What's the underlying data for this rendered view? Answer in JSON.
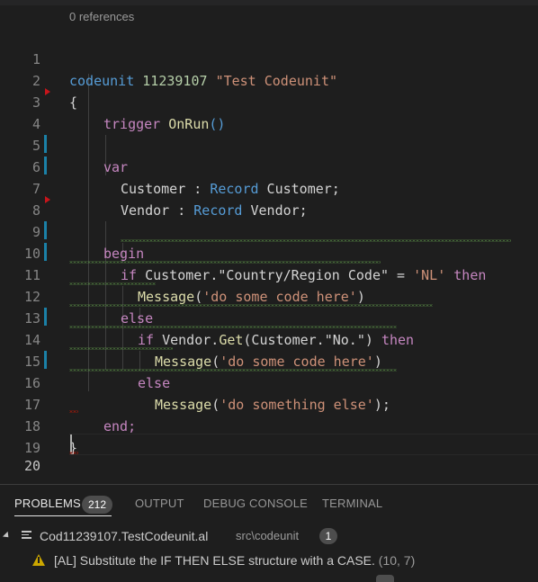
{
  "editor": {
    "codelens": "0 references",
    "lines": [
      {
        "n": "1",
        "text": "codeunit 11239107 \"Test Codeunit\""
      },
      {
        "n": "2",
        "text": "{"
      },
      {
        "n": "3",
        "text": "trigger OnRun()"
      },
      {
        "n": "4",
        "text": ""
      },
      {
        "n": "5",
        "text": "var"
      },
      {
        "n": "6",
        "text": "Customer : Record Customer;"
      },
      {
        "n": "7",
        "text": "Vendor : Record Vendor;"
      },
      {
        "n": "8",
        "text": ""
      },
      {
        "n": "9",
        "text": "begin"
      },
      {
        "n": "10",
        "text": "if Customer.\"Country/Region Code\" = 'NL' then"
      },
      {
        "n": "11",
        "text": "Message('do some code here')"
      },
      {
        "n": "12",
        "text": "else"
      },
      {
        "n": "13",
        "text": "if Vendor.Get(Customer.\"No.\") then"
      },
      {
        "n": "14",
        "text": "Message('do some code here')"
      },
      {
        "n": "15",
        "text": "else"
      },
      {
        "n": "16",
        "text": "Message('do something else');"
      },
      {
        "n": "17",
        "text": "end;"
      },
      {
        "n": "18",
        "text": "}"
      },
      {
        "n": "19",
        "text": ""
      },
      {
        "n": "20",
        "text": ""
      }
    ],
    "tokens": {
      "l1_kw": "codeunit",
      "l1_num": "11239107",
      "l1_str": "\"Test Codeunit\"",
      "l2": "{",
      "l3_kw": "trigger",
      "l3_fn": "OnRun",
      "l3_paren": "()",
      "l5_kw": "var",
      "l6_a": "Customer : ",
      "l6_t": "Record",
      "l6_b": " Customer;",
      "l7_a": "Vendor : ",
      "l7_t": "Record",
      "l7_b": " Vendor;",
      "l9_kw": "begin",
      "l10_if": "if",
      "l10_a": " Customer.\"Country/Region Code\" = ",
      "l10_str": "'NL'",
      "l10_then": "then",
      "l11_fn": "Message",
      "l11_p1": "(",
      "l11_str": "'do some code here'",
      "l11_p2": ")",
      "l12_kw": "else",
      "l13_if": "if",
      "l13_a": " Vendor.",
      "l13_fn": "Get",
      "l13_b": "(Customer.\"No.\")",
      "l13_then": "then",
      "l14_fn": "Message",
      "l14_p1": "(",
      "l14_str": "'do some code here'",
      "l14_p2": ")",
      "l15_kw": "else",
      "l16_fn": "Message",
      "l16_p1": "(",
      "l16_str": "'do something else'",
      "l16_p2": ");",
      "l17_kw": "end;",
      "l18": "}"
    }
  },
  "panel": {
    "tabs": {
      "problems": "PROBLEMS",
      "problems_count": "212",
      "output": "OUTPUT",
      "debug_console": "DEBUG CONSOLE",
      "terminal": "TERMINAL"
    },
    "file": {
      "name": "Cod11239107.TestCodeunit.al",
      "path": "src\\codeunit",
      "count": "1"
    },
    "warning": {
      "text": "[AL] Substitute the IF THEN ELSE structure with a CASE.",
      "position": "(10, 7)"
    }
  },
  "colors": {
    "background": "#1e1e1e",
    "keyword": "#569cd6",
    "control": "#c586c0",
    "string": "#ce9178",
    "number": "#b5cea8",
    "function": "#dcdcaa",
    "warning_squiggle": "#66a84e",
    "error_squiggle": "#e51400",
    "warning_icon": "#cca700",
    "modified_gutter": "#1b81a8"
  }
}
